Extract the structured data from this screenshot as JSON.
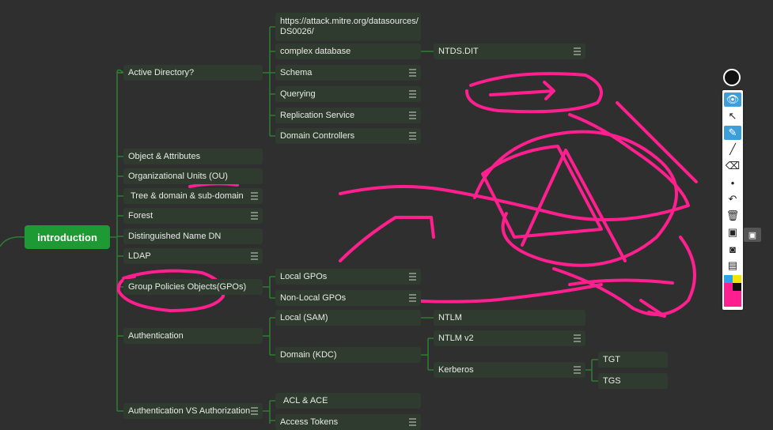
{
  "colors": {
    "background": "#2f2f2f",
    "node_bg": "#2e3b2e",
    "root_bg": "#1e9a34",
    "connector": "#2f7d33",
    "annotation_ink": "#ff1f8e",
    "toolbar_selected": "#3d9fd9"
  },
  "mindmap": {
    "root": "introduction",
    "branches": {
      "active_directory": "Active Directory?",
      "object_attributes": "Object & Attributes",
      "organizational_units": "Organizational Units (OU)",
      "tree_domain": "Tree & domain & sub-domain",
      "forest": "Forest",
      "distinguished_name": "Distinguished Name DN",
      "ldap": "LDAP",
      "group_policies": "Group Policies Objects(GPOs)",
      "authentication": "Authentication",
      "auth_vs_authz": "Authentication VS Authorization"
    },
    "ad_children": {
      "url": "https://attack.mitre.org/datasources/\nDS0026/",
      "complex_database": "complex database",
      "schema": "Schema",
      "querying": "Querying",
      "replication_service": "Replication Service",
      "domain_controllers": "Domain Controllers"
    },
    "ntds": "NTDS.DIT",
    "gpo_children": {
      "local": "Local GPOs",
      "non_local": "Non-Local GPOs"
    },
    "auth_children": {
      "local_sam": "Local (SAM)",
      "domain_kdc": "Domain (KDC)"
    },
    "ntlm": "NTLM",
    "kdc_children": {
      "ntlm_v2": "NTLM v2",
      "kerberos": "Kerberos"
    },
    "kerberos_children": {
      "tgt": "TGT",
      "tgs": "TGS"
    },
    "authz_children": {
      "acl_ace": "ACL & ACE",
      "access_tokens": "Access Tokens"
    }
  },
  "toolbar": {
    "tools": [
      "pen-icon",
      "eye-icon",
      "pointer-icon",
      "highlighter-icon",
      "marker-icon",
      "eraser-icon",
      "dot-size-icon",
      "undo-icon",
      "trash-icon",
      "whiteboard-icon",
      "camera-icon",
      "clipboard-icon",
      "color-swatch-icon"
    ]
  }
}
